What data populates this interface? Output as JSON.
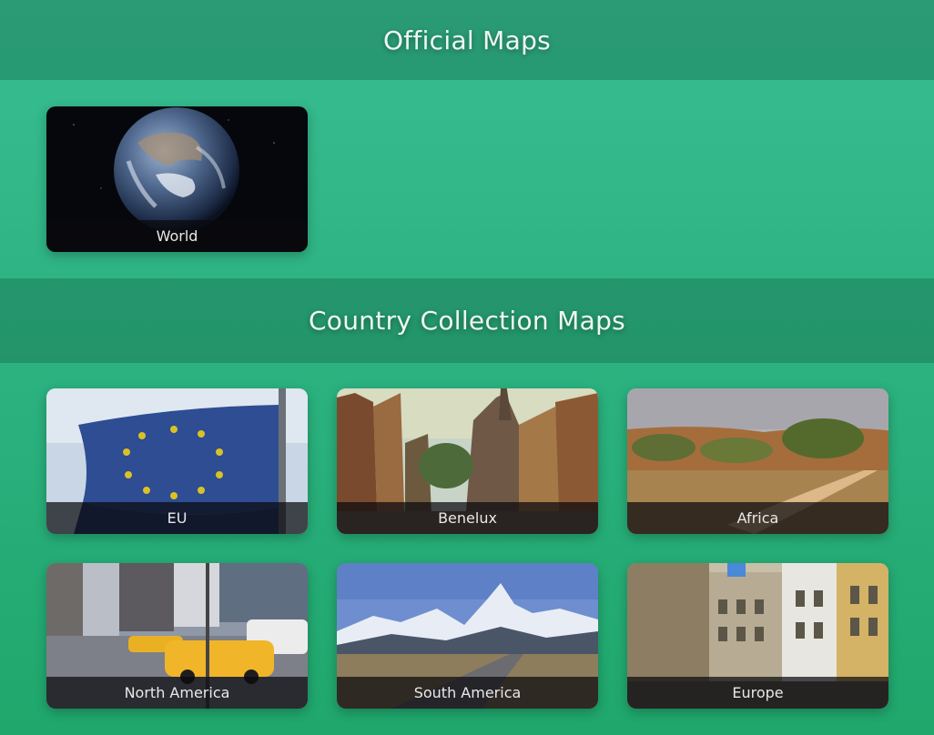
{
  "sections": {
    "official": {
      "title": "Official Maps",
      "cards": [
        {
          "label": "World",
          "image": "earth-from-space"
        }
      ]
    },
    "country": {
      "title": "Country Collection Maps",
      "cards": [
        {
          "label": "EU",
          "image": "eu-flag"
        },
        {
          "label": "Benelux",
          "image": "dutch-old-town-painting"
        },
        {
          "label": "Africa",
          "image": "savanna-landscape"
        },
        {
          "label": "North America",
          "image": "city-street-yellow-taxis"
        },
        {
          "label": "South America",
          "image": "mountain-road-patagonia"
        },
        {
          "label": "Europe",
          "image": "european-old-street"
        }
      ]
    }
  },
  "colors": {
    "background_top": "#37bd91",
    "background_bottom": "#1fa76c",
    "header_band": "#1f7a57",
    "caption_bar": "#0a0a0e"
  }
}
